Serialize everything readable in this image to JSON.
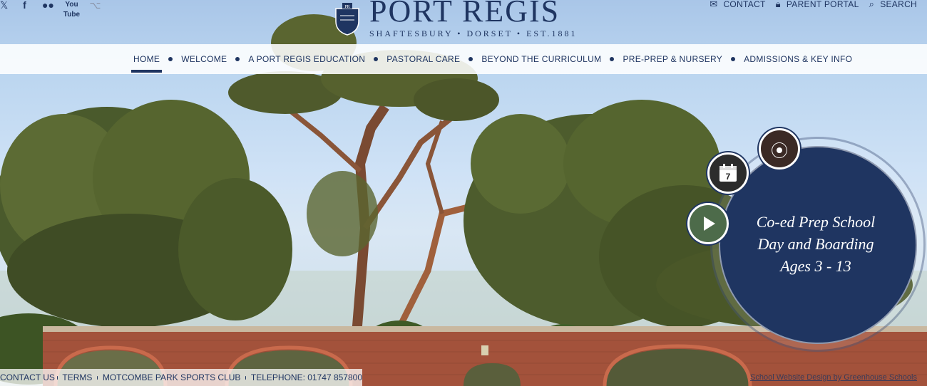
{
  "brand": {
    "title": "PORT REGIS",
    "subtitle": "SHAFTESBURY • DORSET • EST.1881",
    "navy": "#1f3561"
  },
  "social": [
    "twitter-icon",
    "facebook-icon",
    "flickr-icon",
    "youtube-icon",
    "share-icon"
  ],
  "utility": {
    "contact": "CONTACT",
    "parent_portal": "PARENT PORTAL",
    "search": "SEARCH"
  },
  "nav": {
    "items": [
      {
        "label": "HOME"
      },
      {
        "label": "WELCOME"
      },
      {
        "label": "A PORT REGIS EDUCATION"
      },
      {
        "label": "PASTORAL CARE"
      },
      {
        "label": "BEYOND THE CURRICULUM"
      },
      {
        "label": "PRE-PREP & NURSERY"
      },
      {
        "label": "ADMISSIONS & KEY INFO"
      }
    ]
  },
  "panel": {
    "line1": "Co-ed Prep School",
    "line2": "Day and Boarding",
    "line3": "Ages 3 - 13",
    "calendar_day": "7"
  },
  "footer": {
    "contact": "CONTACT US",
    "terms": "TERMS",
    "sports": "MOTCOMBE PARK SPORTS CLUB",
    "telephone": "TELEPHONE: 01747 857800",
    "credit": "School Website Design by Greenhouse Schools"
  }
}
